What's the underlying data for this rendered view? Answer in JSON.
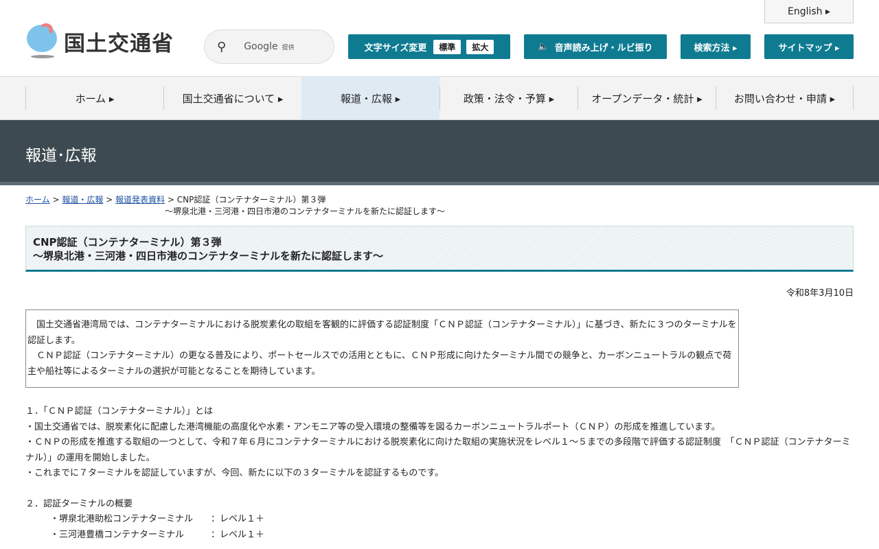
{
  "header": {
    "logo": "国土交通省",
    "search_label": "Google",
    "search_sub": "提供",
    "english": "English ▸",
    "font_size": "文字サイズ変更",
    "font_std": "標準",
    "font_large": "拡大",
    "speech": "音声読み上げ・ルビ振り",
    "search_method": "検索方法 ▸",
    "sitemap": "サイトマップ ▸"
  },
  "nav": [
    "ホーム ▸",
    "国土交通省について ▸",
    "報道・広報 ▸",
    "政策・法令・予算 ▸",
    "オープンデータ・統計 ▸",
    "お問い合わせ・申請 ▸"
  ],
  "band_title": "報道･広報",
  "breadcrumb": {
    "home": "ホーム",
    "press": "報道・広報",
    "releases": "報道発表資料",
    "current1": "CNP認証（コンテナターミナル）第３弾",
    "current2": "～堺泉北港・三河港・四日市港のコンテナターミナルを新たに認証します～"
  },
  "title": {
    "line1": "CNP認証（コンテナターミナル）第３弾",
    "line2": "～堺泉北港・三河港・四日市港のコンテナターミナルを新たに認証します～"
  },
  "date": "令和8年3月10日",
  "lead": [
    "　国土交通省港湾局では、コンテナターミナルにおける脱炭素化の取組を客観的に評価する認証制度「ＣＮＰ認証（コンテナターミナル）」に基づき、新たに３つのターミナルを認証します。",
    "　ＣＮＰ認証（コンテナターミナル）の更なる普及により、ポートセールスでの活用とともに、ＣＮＰ形成に向けたターミナル間での競争と、カーボンニュートラルの観点で荷主や船社等によるターミナルの選択が可能となることを期待しています。"
  ],
  "sec1": {
    "heading": "１．「ＣＮＰ認証（コンテナターミナル）」とは",
    "items": [
      "・国土交通省では、脱炭素化に配慮した港湾機能の高度化や水素・アンモニア等の受入環境の整備等を図るカーボンニュートラルポート（ＣＮＰ）の形成を推進しています。",
      "・ＣＮＰの形成を推進する取組の一つとして、令和７年６月にコンテナターミナルにおける脱炭素化に向けた取組の実施状況をレベル１～５までの多段階で評価する認証制度　「ＣＮＰ認証（コンテナターミナル）」の運用を開始しました。",
      "・これまでに７ターミナルを認証していますが、今回、新たに以下の３ターミナルを認証するものです。"
    ]
  },
  "sec2": {
    "heading": "２．認証ターミナルの概要",
    "items": [
      "・堺泉北港助松コンテナターミナル　　：レベル１＋",
      "・三河港豊橋コンテナターミナル　　　：レベル１＋"
    ]
  }
}
